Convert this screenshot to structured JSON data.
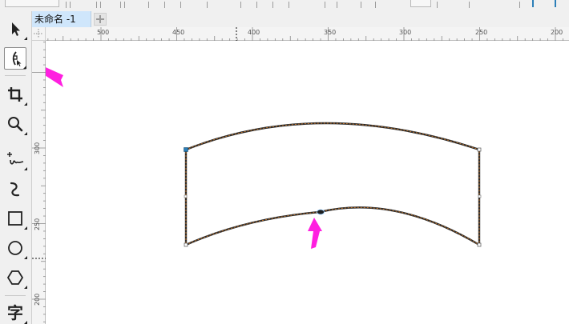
{
  "document": {
    "tab_title": "未命名 -1"
  },
  "toolbox": {
    "tools": [
      {
        "id": "pick",
        "icon": "pointer-arrow-icon"
      },
      {
        "id": "shape",
        "icon": "shape-node-icon",
        "active": true
      },
      {
        "id": "crop",
        "icon": "crop-icon"
      },
      {
        "id": "zoom",
        "icon": "magnifier-icon"
      },
      {
        "id": "freehand",
        "icon": "freehand-icon"
      },
      {
        "id": "artistic-media",
        "icon": "curve-s-icon"
      },
      {
        "id": "rectangle",
        "icon": "rectangle-icon"
      },
      {
        "id": "ellipse",
        "icon": "ellipse-icon"
      },
      {
        "id": "polygon",
        "icon": "hexagon-icon"
      },
      {
        "id": "text",
        "icon": "text-tool-icon",
        "label": "字"
      }
    ]
  },
  "rulers": {
    "horizontal_labels": [
      "500",
      "450",
      "400",
      "350",
      "300",
      "250",
      "200"
    ],
    "vertical_labels": [
      "300",
      "250",
      "200"
    ]
  },
  "colors": {
    "annotation_arrow": "#ff1fe0",
    "path_stroke": "#2a2a2a",
    "path_dash": "#d07a2a",
    "active_tab": "#cfe6fb",
    "node_blue": "#2c7fb8"
  }
}
